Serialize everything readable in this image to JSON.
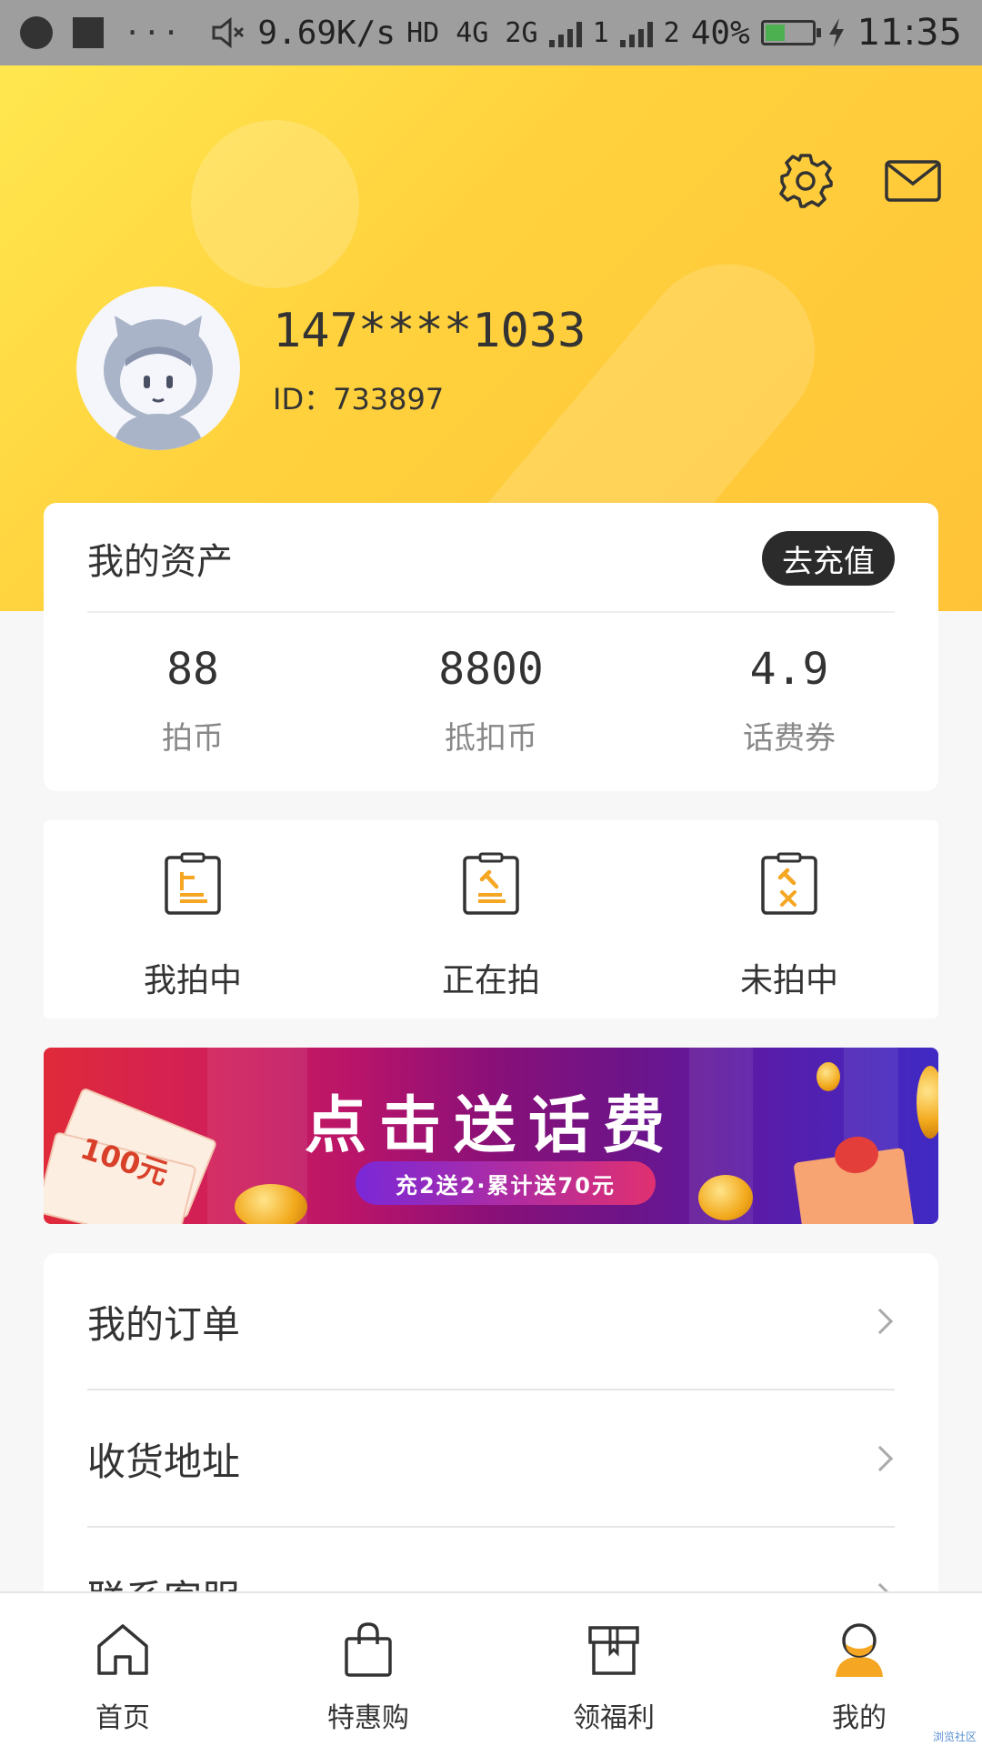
{
  "status_bar": {
    "network_speed": "9.69K/s",
    "network_types": "HD 4G 2G",
    "sim1": "1",
    "sim2": "2",
    "battery": "40%",
    "time": "11:35"
  },
  "profile": {
    "phone": "147****1033",
    "id_label": "ID：733897"
  },
  "assets": {
    "title": "我的资产",
    "recharge_label": "去充值",
    "items": [
      {
        "value": "88",
        "label": "拍币"
      },
      {
        "value": "8800",
        "label": "抵扣币"
      },
      {
        "value": "4.9",
        "label": "话费券"
      }
    ]
  },
  "auctions": [
    {
      "label": "我拍中",
      "icon": "clipboard-won-icon"
    },
    {
      "label": "正在拍",
      "icon": "clipboard-bidding-icon"
    },
    {
      "label": "未拍中",
      "icon": "clipboard-lost-icon"
    }
  ],
  "banner": {
    "title": "点击送话费",
    "subtitle": "充2送2·累计送70元",
    "ticket_text": "100元"
  },
  "menu": [
    {
      "label": "我的订单"
    },
    {
      "label": "收货地址"
    },
    {
      "label": "联系客服"
    }
  ],
  "tabbar": [
    {
      "label": "首页",
      "icon": "home-icon"
    },
    {
      "label": "特惠购",
      "icon": "shopping-bag-icon"
    },
    {
      "label": "领福利",
      "icon": "gift-box-icon"
    },
    {
      "label": "我的",
      "icon": "user-icon"
    }
  ],
  "watermark": "浏览社区",
  "colors": {
    "header_yellow": "#ffd23d",
    "accent_orange": "#f5a623",
    "dark_button": "#2b2b2b"
  }
}
